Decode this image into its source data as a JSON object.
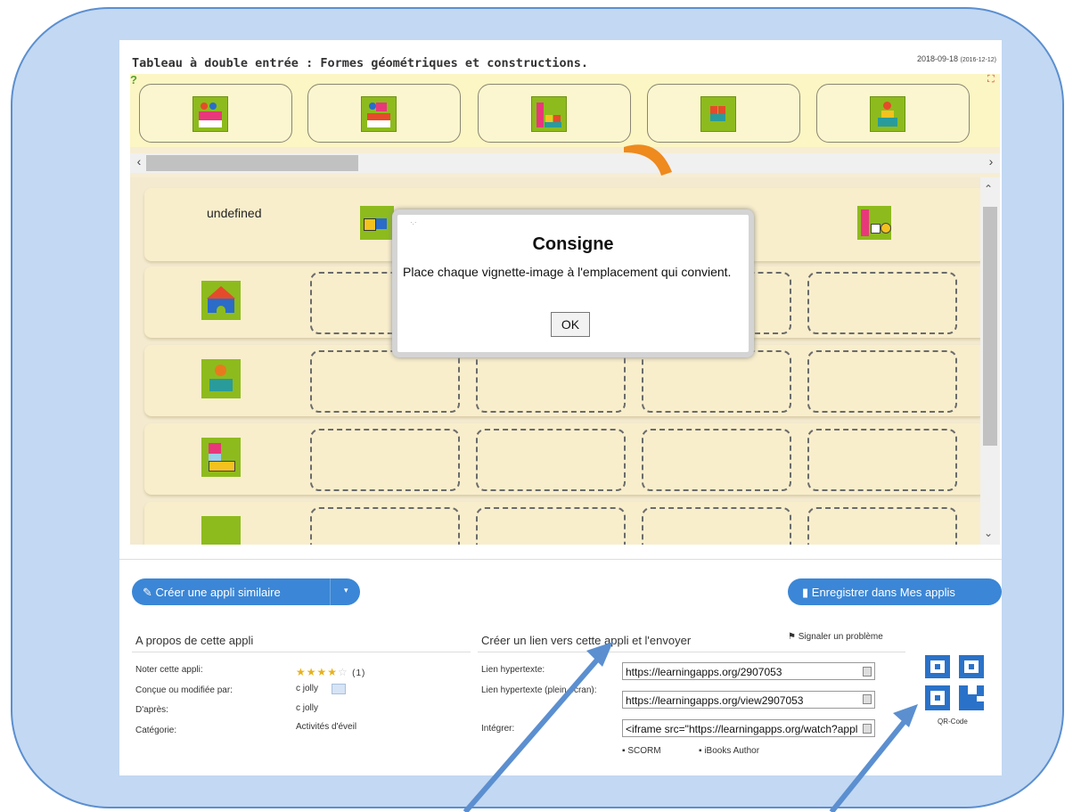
{
  "header": {
    "title": "Tableau à double entrée : Formes géométriques et constructions.",
    "date": "2018-09-18",
    "date_small": "(2016-12-12)"
  },
  "dialog": {
    "title": "Consigne",
    "message": "Place chaque vignette-image à l'emplacement qui convient.",
    "ok_label": "OK",
    "dots": "·.·"
  },
  "board": {
    "corner_label": "undefined"
  },
  "toolbar": {
    "create_label": "Créer une appli similaire",
    "create_icon": "edit-icon",
    "save_label": "Enregistrer dans Mes applis",
    "save_icon": "bookmark-icon"
  },
  "about": {
    "title": "A propos de cette appli",
    "rate_label": "Noter cette appli:",
    "rating_count": "(1)",
    "rating_stars": 4,
    "author_label": "Conçue ou modifiée par:",
    "author": "c jolly",
    "based_on_label": "D'après:",
    "based_on": "c jolly",
    "category_label": "Catégorie:",
    "category": "Activités d'éveil"
  },
  "share": {
    "title": "Créer un lien vers cette appli et l'envoyer",
    "report_label": "Signaler un problème",
    "link_label": "Lien hypertexte:",
    "link_value": "https://learningapps.org/2907053",
    "fullscreen_label": "Lien hypertexte (plein écran):",
    "fullscreen_value": "https://learningapps.org/view2907053",
    "embed_label": "Intégrer:",
    "embed_value": "<iframe src=\"https://learningapps.org/watch?appl",
    "scorm_label": "SCORM",
    "ibooks_label": "iBooks Author",
    "qr_label": "QR-Code"
  },
  "colors": {
    "frame_bg": "#c3d8f2",
    "frame_border": "#5b8fd0",
    "button_blue": "#3b86d6",
    "tile_green": "#8dbb1d",
    "arrow_blue": "#5b8fd0",
    "qr_blue": "#2a72c9"
  }
}
